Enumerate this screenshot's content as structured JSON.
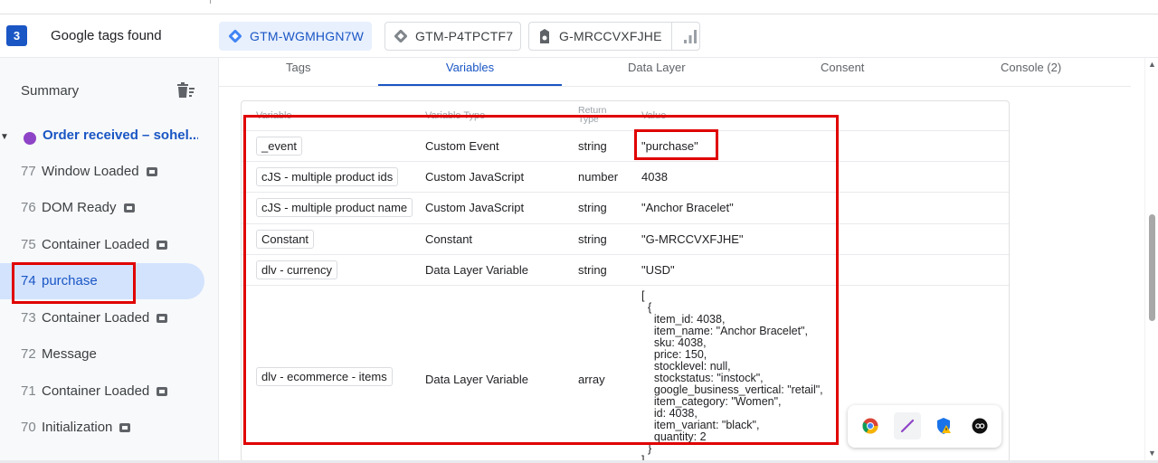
{
  "header": {
    "tags_count": "3",
    "tags_found_label": "Google tags found",
    "chips": [
      {
        "label": "GTM-WGMHGN7W",
        "icon": "gtm-diamond-icon",
        "active": true
      },
      {
        "label": "GTM-P4TPCTF7",
        "icon": "gtm-diamond-icon",
        "active": false
      },
      {
        "label": "G-MRCCVXFJHE",
        "icon": "ga-tag-icon",
        "active": false
      }
    ]
  },
  "sidebar": {
    "summary_label": "Summary",
    "page_title": "Order received – sohel...",
    "events": [
      {
        "num": "77",
        "name": "Window Loaded",
        "has_icon": true
      },
      {
        "num": "76",
        "name": "DOM Ready",
        "has_icon": true
      },
      {
        "num": "75",
        "name": "Container Loaded",
        "has_icon": true
      },
      {
        "num": "74",
        "name": "purchase",
        "has_icon": false,
        "selected": true
      },
      {
        "num": "73",
        "name": "Container Loaded",
        "has_icon": true
      },
      {
        "num": "72",
        "name": "Message",
        "has_icon": false
      },
      {
        "num": "71",
        "name": "Container Loaded",
        "has_icon": true
      },
      {
        "num": "70",
        "name": "Initialization",
        "has_icon": true
      }
    ]
  },
  "tabs": [
    {
      "label": "Tags",
      "active": false
    },
    {
      "label": "Variables",
      "active": true
    },
    {
      "label": "Data Layer",
      "active": false
    },
    {
      "label": "Consent",
      "active": false
    },
    {
      "label": "Console (2)",
      "active": false
    }
  ],
  "table": {
    "headers": {
      "variable": "Variable",
      "variable_type": "Variable Type",
      "return_type": "Return Type",
      "value": "Value"
    },
    "rows": [
      {
        "name": "_event",
        "type": "Custom Event",
        "return": "string",
        "value": "\"purchase\""
      },
      {
        "name": "cJS - multiple product ids",
        "type": "Custom JavaScript",
        "return": "number",
        "value": "4038"
      },
      {
        "name": "cJS - multiple product name",
        "type": "Custom JavaScript",
        "return": "string",
        "value": "\"Anchor Bracelet\""
      },
      {
        "name": "Constant",
        "type": "Constant",
        "return": "string",
        "value": "\"G-MRCCVXFJHE\""
      },
      {
        "name": "dlv - currency",
        "type": "Data Layer Variable",
        "return": "string",
        "value": "\"USD\""
      },
      {
        "name": "dlv - ecommerce - items",
        "type": "Data Layer Variable",
        "return": "array",
        "value": "[\n  {\n    item_id: 4038,\n    item_name: \"Anchor Bracelet\",\n    sku: 4038,\n    price: 150,\n    stocklevel: null,\n    stockstatus: \"instock\",\n    google_business_vertical: \"retail\",\n    item_category: \"Women\",\n    id: 4038,\n    item_variant: \"black\",\n    quantity: 2\n  }\n]"
      }
    ]
  },
  "extensions": [
    "chrome-icon",
    "pen-extension-icon",
    "shield-warning-extension-icon",
    "bo-extension-icon"
  ],
  "colors": {
    "accent": "#1a56c4",
    "highlight": "#e00000",
    "selected_bg": "#d3e3fd"
  }
}
